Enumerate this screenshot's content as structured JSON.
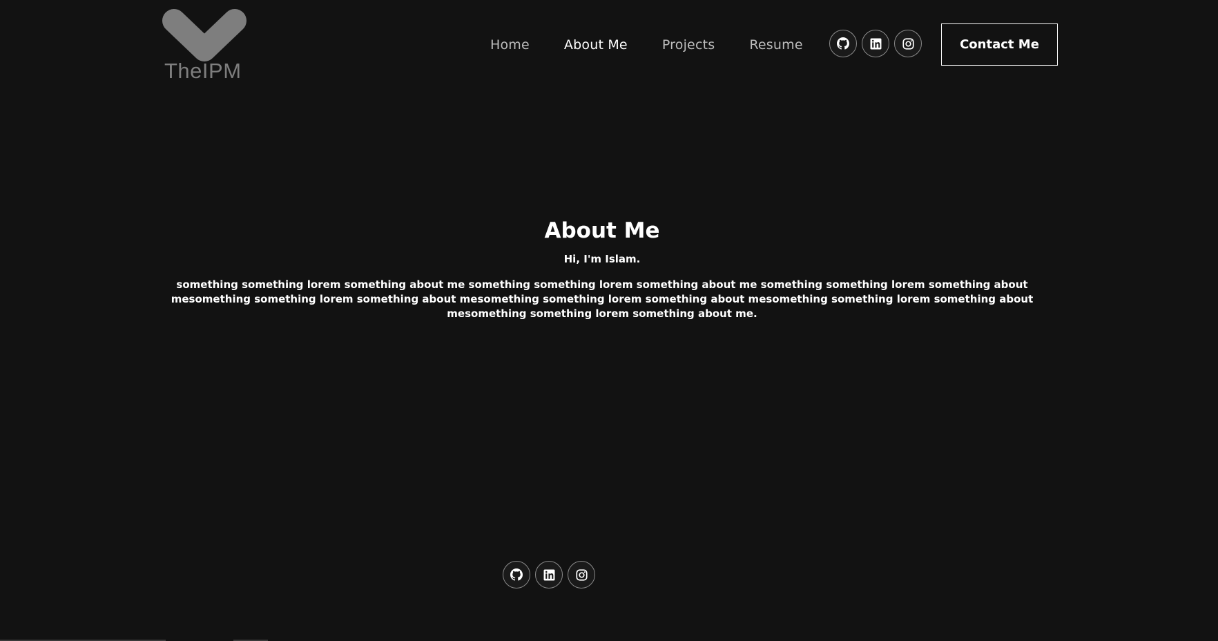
{
  "logo": {
    "text": "TheIPM",
    "color": "#7e7e7e"
  },
  "nav": {
    "items": [
      {
        "label": "Home",
        "active": false
      },
      {
        "label": "About Me",
        "active": true
      },
      {
        "label": "Projects",
        "active": false
      },
      {
        "label": "Resume",
        "active": false
      }
    ]
  },
  "social": {
    "icons": [
      "github-icon",
      "linkedin-icon",
      "instagram-icon"
    ]
  },
  "contact_button": {
    "label": "Contact Me"
  },
  "about": {
    "title": "About Me",
    "subtitle": "Hi, I'm Islam.",
    "body": "something something lorem something about me something something lorem something about me something something lorem something about mesomething something lorem something about mesomething something lorem something about mesomething something lorem something about mesomething something lorem something about me."
  },
  "colors": {
    "background": "#121212",
    "text": "#ffffff",
    "nav_inactive": "#bdbdbd",
    "icon_border": "#8a8a8a"
  }
}
